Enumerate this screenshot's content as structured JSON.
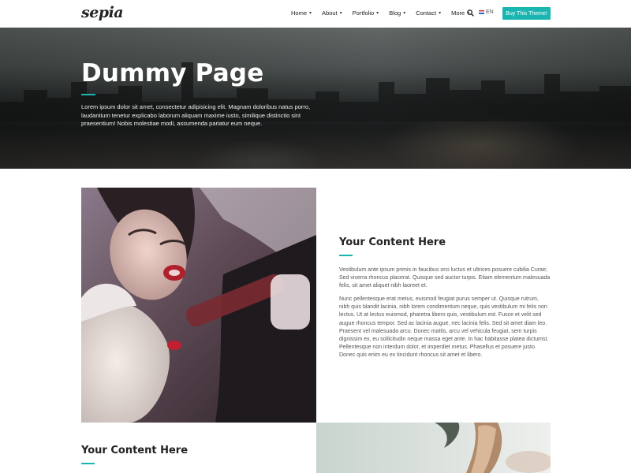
{
  "nav": {
    "logo": "sepia",
    "items": [
      {
        "label": "Home"
      },
      {
        "label": "About"
      },
      {
        "label": "Portfolio"
      },
      {
        "label": "Blog"
      },
      {
        "label": "Contact"
      },
      {
        "label": "More"
      }
    ],
    "language": "EN",
    "buy_button": "Buy This Theme!",
    "icons": {
      "search": "search-icon",
      "dropdown": "chevron-down-icon",
      "flag": "uk-flag-icon"
    }
  },
  "hero": {
    "title": "Dummy Page",
    "text": "Lorem ipsum dolor sit amet, consectetur adipisicing elit. Magnam doloribus natus porro, laudantium tenetur explicabo laborum aliquam maxime iusto, similique distinctio sint praesentium! Nobis molestiae modi, assumenda pariatur eum neque."
  },
  "section1": {
    "title": "Your Content Here",
    "paragraph1": "Vestibulum ante ipsum primis in faucibus orci luctus et ultrices posuere cubilia Curae; Sed viverra rhoncus placerat. Quisque sed auctor turpis. Etiam elementum malesuada felis, sit amet aliquet nibh laoreet et.",
    "paragraph2": "Nunc pellentesque erat metus, euismod feugiat purus semper ut. Quisque rutrum, nibh quis blandit lacinia, nibh lorem condimentum neque, quis vestibulum mi felis non lectus. Ut at lectus euismod, pharetra libero quis, vestibulum est. Fusce et velit sed augue rhoncus tempor. Sed ac lacinia augue, nec lacinia felis. Sed sit amet diam leo. Praesent vel malesuada arcu. Donec mattis, arcu vel vehicula feugiat, sem turpis dignissim ex, eu sollicitudin neque massa eget ante. In hac habitasse platea dictumst. Pellentesque non interdum dolor, et imperdiet metus. Phasellus et posuere justo. Donec quis enim eu ex tincidunt rhoncus sit amet et libero."
  },
  "section2": {
    "title": "Your Content Here"
  },
  "colors": {
    "accent": "#19b5b1",
    "text": "#555555",
    "heading": "#222222"
  }
}
